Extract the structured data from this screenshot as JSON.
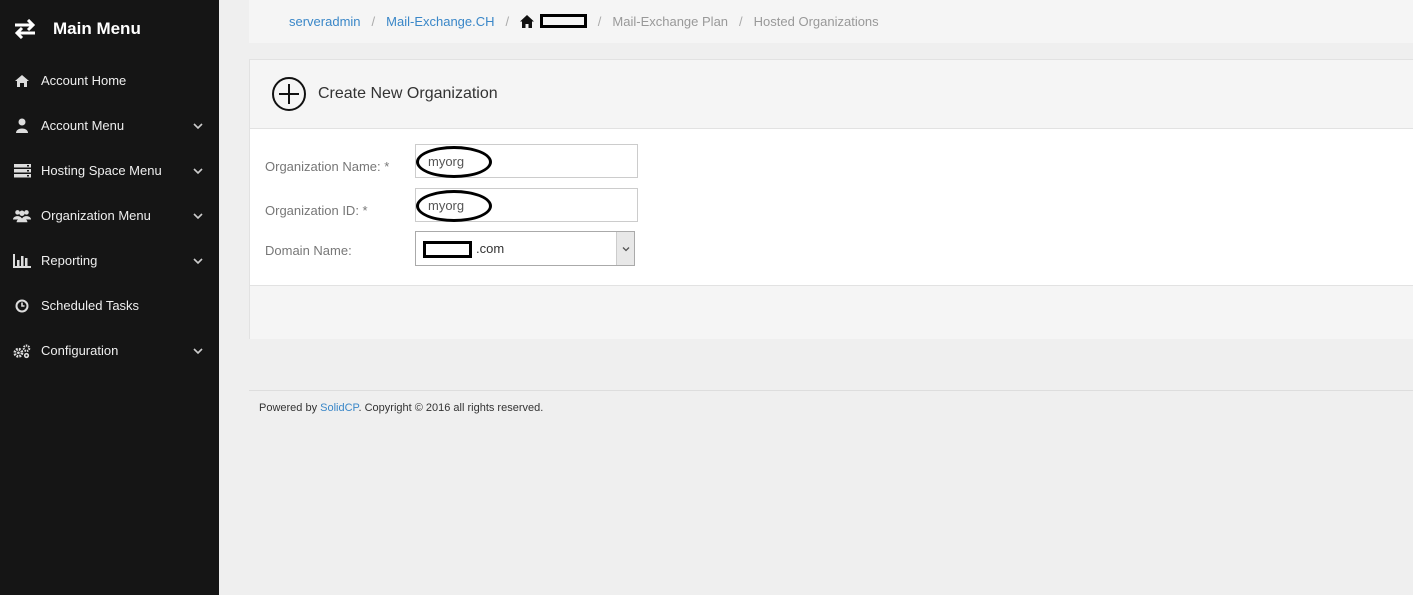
{
  "sidebar": {
    "title": "Main Menu",
    "items": [
      {
        "label": "Account Home",
        "icon": "home-icon",
        "has_submenu": false
      },
      {
        "label": "Account Menu",
        "icon": "user-icon",
        "has_submenu": true
      },
      {
        "label": "Hosting Space Menu",
        "icon": "server-icon",
        "has_submenu": true
      },
      {
        "label": "Organization Menu",
        "icon": "users-icon",
        "has_submenu": true
      },
      {
        "label": "Reporting",
        "icon": "bar-chart-icon",
        "has_submenu": true
      },
      {
        "label": "Scheduled Tasks",
        "icon": "clock-icon",
        "has_submenu": false
      },
      {
        "label": "Configuration",
        "icon": "gears-icon",
        "has_submenu": true
      }
    ]
  },
  "breadcrumb": {
    "items": [
      "serveradmin",
      "Mail-Exchange.CH",
      "Mail-Exchange Plan",
      "Hosted Organizations"
    ]
  },
  "panel": {
    "title": "Create New Organization"
  },
  "form": {
    "org_name_label": "Organization Name: *",
    "org_name_value": "myorg",
    "org_id_label": "Organization ID: *",
    "org_id_value": "myorg",
    "domain_label": "Domain Name:",
    "domain_value": ".com"
  },
  "footer": {
    "prefix": "Powered by ",
    "link": "SolidCP",
    "suffix": ". Copyright © 2016 all rights reserved."
  },
  "colors": {
    "sidebar_bg": "#151515",
    "link": "#3a87c8",
    "page_bg": "#efefef"
  }
}
